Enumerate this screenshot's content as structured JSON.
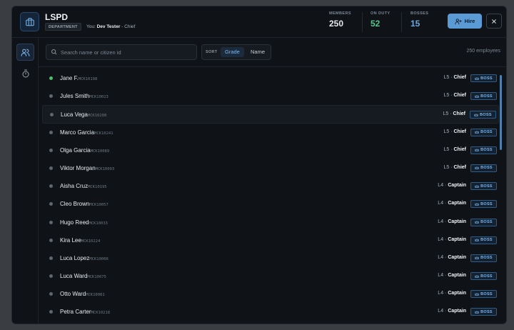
{
  "header": {
    "title": "LSPD",
    "badge": "DEPARTMENT",
    "you_prefix": "You:",
    "you_name": "Dev Tester",
    "you_role": "- Chief",
    "stats": [
      {
        "label": "MEMBERS",
        "value": "250",
        "color": "#e6e8eb"
      },
      {
        "label": "ON DUTY",
        "value": "52",
        "color": "#5bc48a"
      },
      {
        "label": "BOSSES",
        "value": "15",
        "color": "#6fa8dc"
      }
    ],
    "hire_label": "Hire"
  },
  "toolbar": {
    "search_placeholder": "Search name or citizen id",
    "sort_label": "SORT",
    "sort_options": [
      "Grade",
      "Name"
    ],
    "sort_active": "Grade",
    "count": "250 employees"
  },
  "employees": [
    {
      "name": "Jane F.",
      "cid": "MCK10198",
      "level": "L5",
      "rank": "Chief",
      "boss": "BOSS",
      "online": true
    },
    {
      "name": "Jules Smith",
      "cid": "MCK10023",
      "level": "L5",
      "rank": "Chief",
      "boss": "BOSS",
      "online": false
    },
    {
      "name": "Luca Vega",
      "cid": "MCK10208",
      "level": "L5",
      "rank": "Chief",
      "boss": "BOSS",
      "online": false
    },
    {
      "name": "Marco Garcia",
      "cid": "MCK10241",
      "level": "L5",
      "rank": "Chief",
      "boss": "BOSS",
      "online": false
    },
    {
      "name": "Olga Garcia",
      "cid": "MCK10089",
      "level": "L5",
      "rank": "Chief",
      "boss": "BOSS",
      "online": false
    },
    {
      "name": "Viktor Morgan",
      "cid": "MCK10093",
      "level": "L5",
      "rank": "Chief",
      "boss": "BOSS",
      "online": false
    },
    {
      "name": "Aisha Cruz",
      "cid": "MCK10195",
      "level": "L4",
      "rank": "Captain",
      "boss": "BOSS",
      "online": false
    },
    {
      "name": "Cleo Brown",
      "cid": "MCK10057",
      "level": "L4",
      "rank": "Captain",
      "boss": "BOSS",
      "online": false
    },
    {
      "name": "Hugo Reed",
      "cid": "MCK10033",
      "level": "L4",
      "rank": "Captain",
      "boss": "BOSS",
      "online": false
    },
    {
      "name": "Kira Lee",
      "cid": "MCK10224",
      "level": "L4",
      "rank": "Captain",
      "boss": "BOSS",
      "online": false
    },
    {
      "name": "Luca Lopez",
      "cid": "MCK10066",
      "level": "L4",
      "rank": "Captain",
      "boss": "BOSS",
      "online": false
    },
    {
      "name": "Luca Ward",
      "cid": "MCK10075",
      "level": "L4",
      "rank": "Captain",
      "boss": "BOSS",
      "online": false
    },
    {
      "name": "Otto Ward",
      "cid": "MCK10081",
      "level": "L4",
      "rank": "Captain",
      "boss": "BOSS",
      "online": false
    },
    {
      "name": "Petra Carter",
      "cid": "MCK10218",
      "level": "L4",
      "rank": "Captain",
      "boss": "BOSS",
      "online": false
    }
  ],
  "icons": {
    "logo": "briefcase-icon",
    "hire": "user-plus-icon",
    "close": "close-icon",
    "sidebar": [
      "users-icon",
      "stopwatch-icon"
    ],
    "search": "search-icon",
    "boss": "crown-icon"
  },
  "colors": {
    "accent": "#5b9bd5",
    "online": "#49c26a",
    "offline": "#5e6670"
  }
}
